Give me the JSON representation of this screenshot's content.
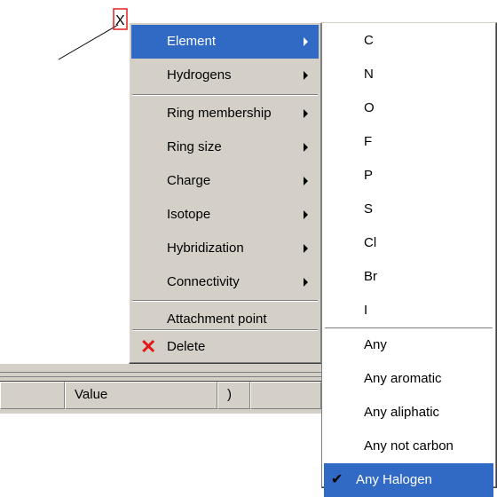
{
  "context_menu": {
    "items": [
      {
        "label": "Element",
        "has_submenu": true,
        "selected": true
      },
      {
        "label": "Hydrogens",
        "has_submenu": true
      },
      {
        "label": "Ring membership",
        "has_submenu": true
      },
      {
        "label": "Ring size",
        "has_submenu": true
      },
      {
        "label": "Charge",
        "has_submenu": true
      },
      {
        "label": "Isotope",
        "has_submenu": true
      },
      {
        "label": "Hybridization",
        "has_submenu": true
      },
      {
        "label": "Connectivity",
        "has_submenu": true
      },
      {
        "label": "Attachment point",
        "has_submenu": false
      },
      {
        "label": "Delete",
        "has_submenu": false,
        "icon": "red-x-icon"
      }
    ]
  },
  "element_submenu": {
    "elements": [
      "C",
      "N",
      "O",
      "F",
      "P",
      "S",
      "Cl",
      "Br",
      "I"
    ],
    "groups": [
      "Any",
      "Any aromatic",
      "Any aliphatic",
      "Any not carbon",
      "Any Halogen"
    ],
    "checked": "Any Halogen"
  },
  "table_header": {
    "columns": [
      "Value",
      ")"
    ]
  },
  "colors": {
    "highlight": "#316ac5",
    "menu_bg": "#d4d0c8",
    "delete_icon": "#e01818",
    "atom_box": "#e02020"
  }
}
